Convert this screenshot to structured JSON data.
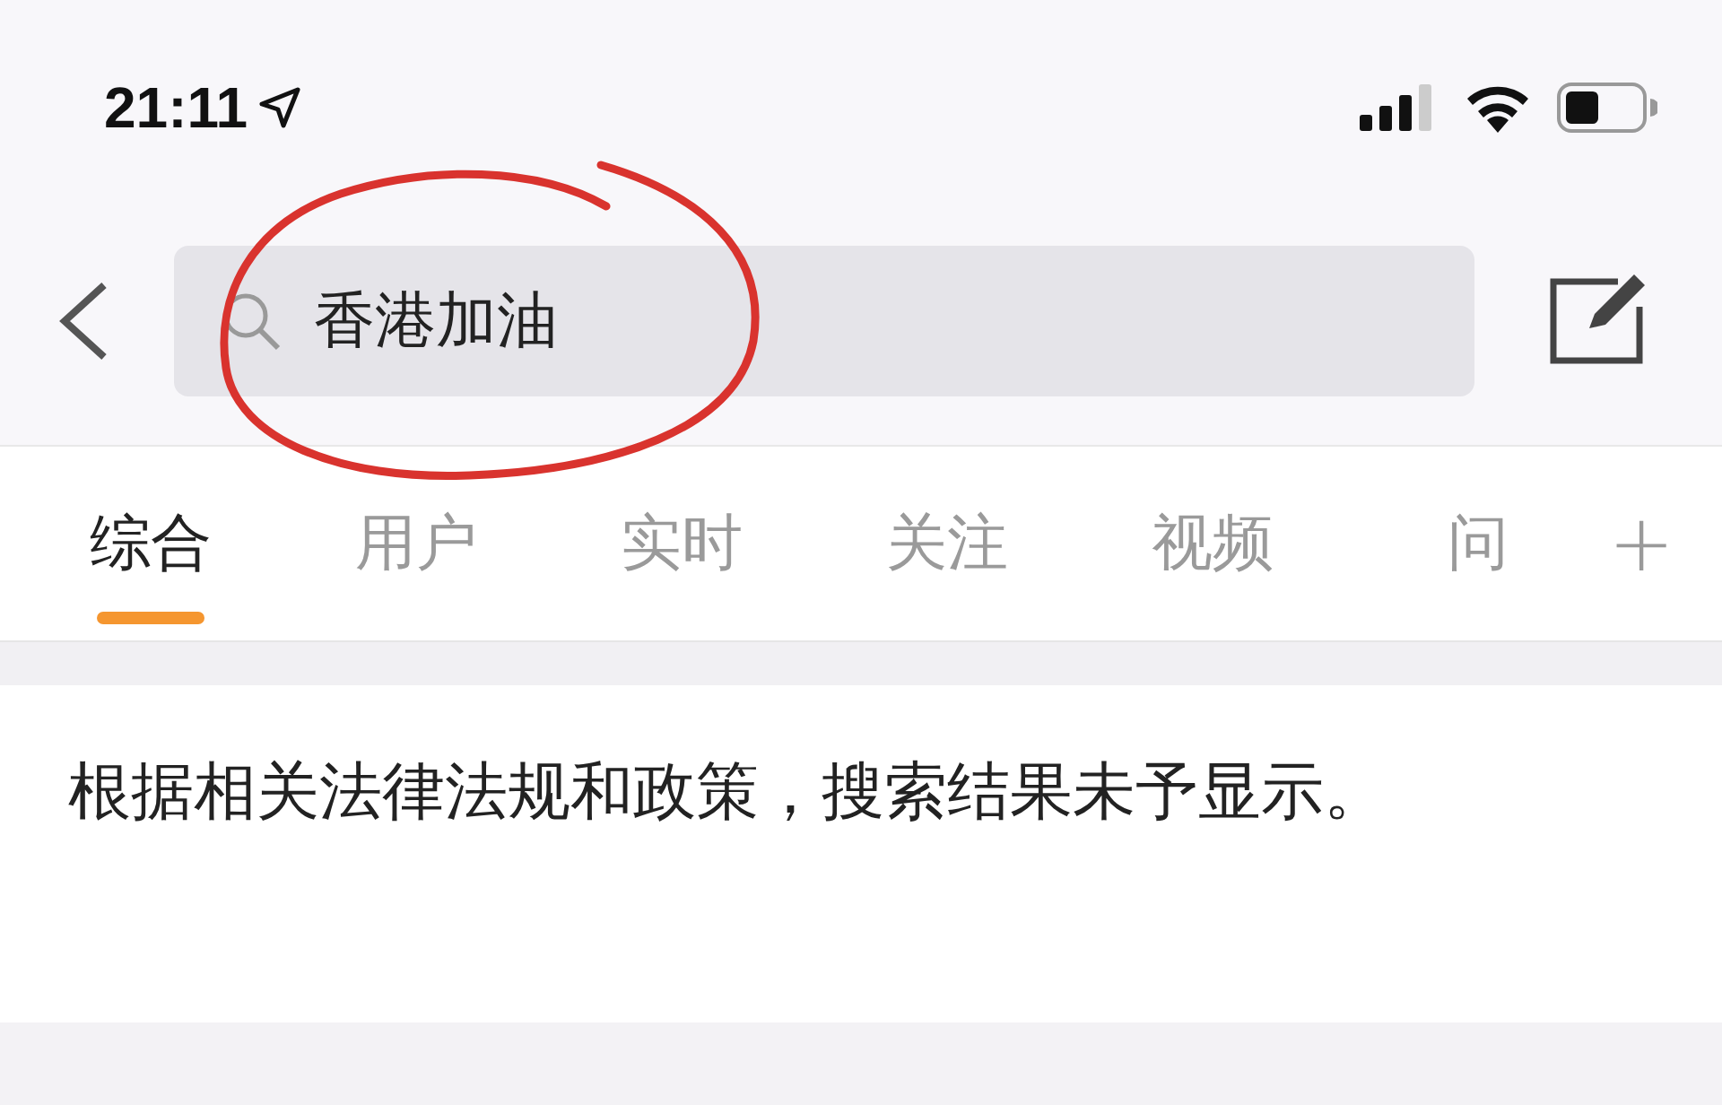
{
  "status_bar": {
    "time": "21:11"
  },
  "search": {
    "value": "香港加油"
  },
  "tabs": [
    {
      "label": "综合",
      "selected": true
    },
    {
      "label": "用户",
      "selected": false
    },
    {
      "label": "实时",
      "selected": false
    },
    {
      "label": "关注",
      "selected": false
    },
    {
      "label": "视频",
      "selected": false
    },
    {
      "label": "问",
      "selected": false
    }
  ],
  "add_tab": "+",
  "notice": "根据相关法律法规和政策，搜索结果未予显示。"
}
